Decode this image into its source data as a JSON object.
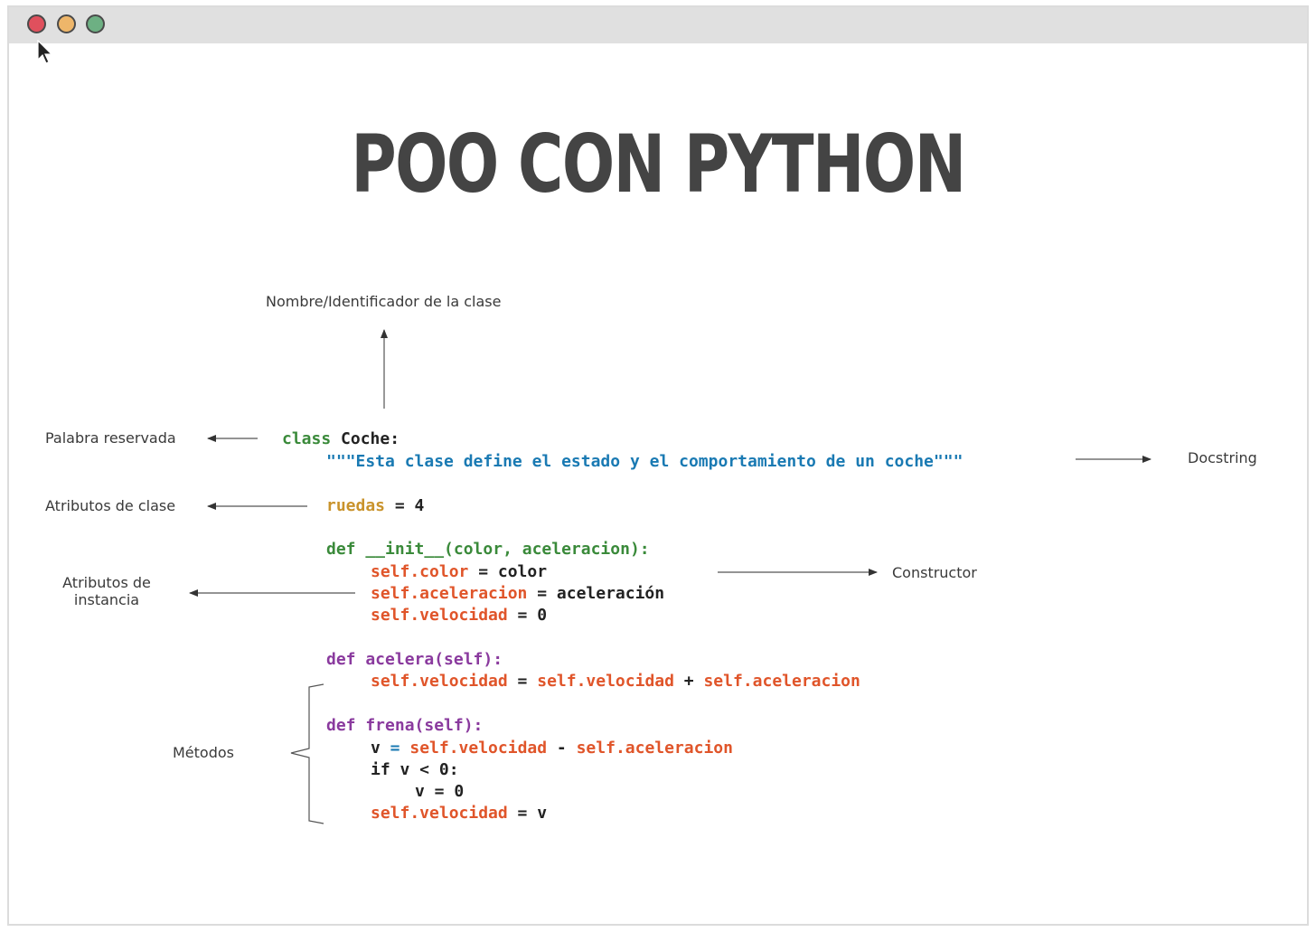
{
  "window": {
    "controls": [
      "close",
      "minimize",
      "maximize"
    ]
  },
  "title": "POO CON PYTHON",
  "labels": {
    "nombre": "Nombre/Identificador de la clase",
    "palabra": "Palabra reservada",
    "docstring": "Docstring",
    "atributos_clase": "Atributos de clase",
    "constructor": "Constructor",
    "atributos_instancia_1": "Atributos de",
    "atributos_instancia_2": "instancia",
    "metodos": "Métodos"
  },
  "code": {
    "l1_kw": "class",
    "l1_name": "Coche:",
    "l2_doc": "\"\"\"Esta clase define el estado y el comportamiento de un coche\"\"\"",
    "l3_attr": "ruedas",
    "l3_rest": " = 4",
    "l4_def": "def __init__(color, aceleracion):",
    "l5_attr": "self.color",
    "l5_rest": " = color",
    "l6_attr": "self.aceleracion",
    "l6_rest": " = aceleración",
    "l7_attr": "self.velocidad",
    "l7_rest": " = 0",
    "l8_def": "def acelera(self):",
    "l9_a": "self.velocidad",
    "l9_eq": " = ",
    "l9_b": "self.velocidad",
    "l9_plus": " + ",
    "l9_c": "self.aceleracion",
    "l10_def": "def frena(self):",
    "l11_v": "v",
    "l11_eq": " = ",
    "l11_a": "self.velocidad",
    "l11_minus": " - ",
    "l11_b": "self.aceleracion",
    "l12": "if v < 0:",
    "l13": "v = 0",
    "l14_attr": "self.velocidad",
    "l14_rest": " = v"
  },
  "colors": {
    "keyword_class": "#3a8a3a",
    "docstring": "#1a7ab3",
    "class_attr": "#c9932c",
    "instance_attr": "#e0552a",
    "method_def": "#8a3a9e",
    "title": "#444444"
  }
}
